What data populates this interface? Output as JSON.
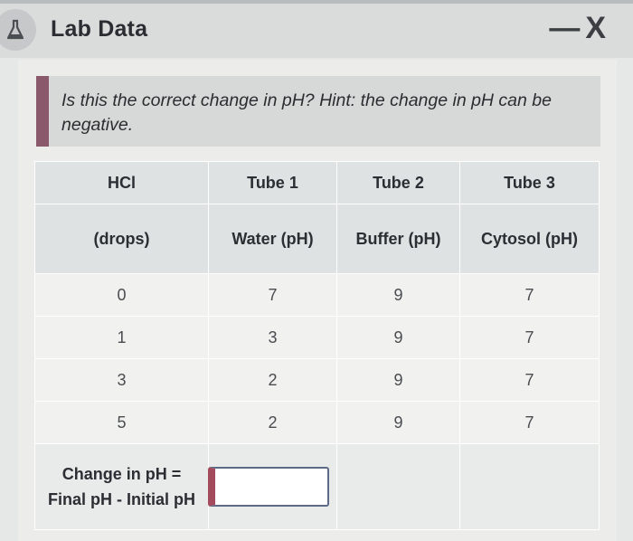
{
  "window": {
    "title": "Lab Data",
    "minimize_symbol": "—",
    "close_symbol": "X",
    "icon": "flask-icon"
  },
  "hint": {
    "text": "Is this the correct change in pH? Hint: the change in pH can be negative."
  },
  "table": {
    "header_row1": [
      "HCl",
      "Tube 1",
      "Tube 2",
      "Tube 3"
    ],
    "header_row2": [
      "(drops)",
      "Water (pH)",
      "Buffer (pH)",
      "Cytosol (pH)"
    ],
    "rows": [
      [
        "0",
        "7",
        "9",
        "7"
      ],
      [
        "1",
        "3",
        "9",
        "7"
      ],
      [
        "3",
        "2",
        "9",
        "7"
      ],
      [
        "5",
        "2",
        "9",
        "7"
      ]
    ],
    "change_label": "Change in pH = Final pH - Initial pH",
    "answer_value": ""
  },
  "colors": {
    "accent_bar": "#8a5a6c",
    "input_error_bar": "#a34a5c"
  }
}
